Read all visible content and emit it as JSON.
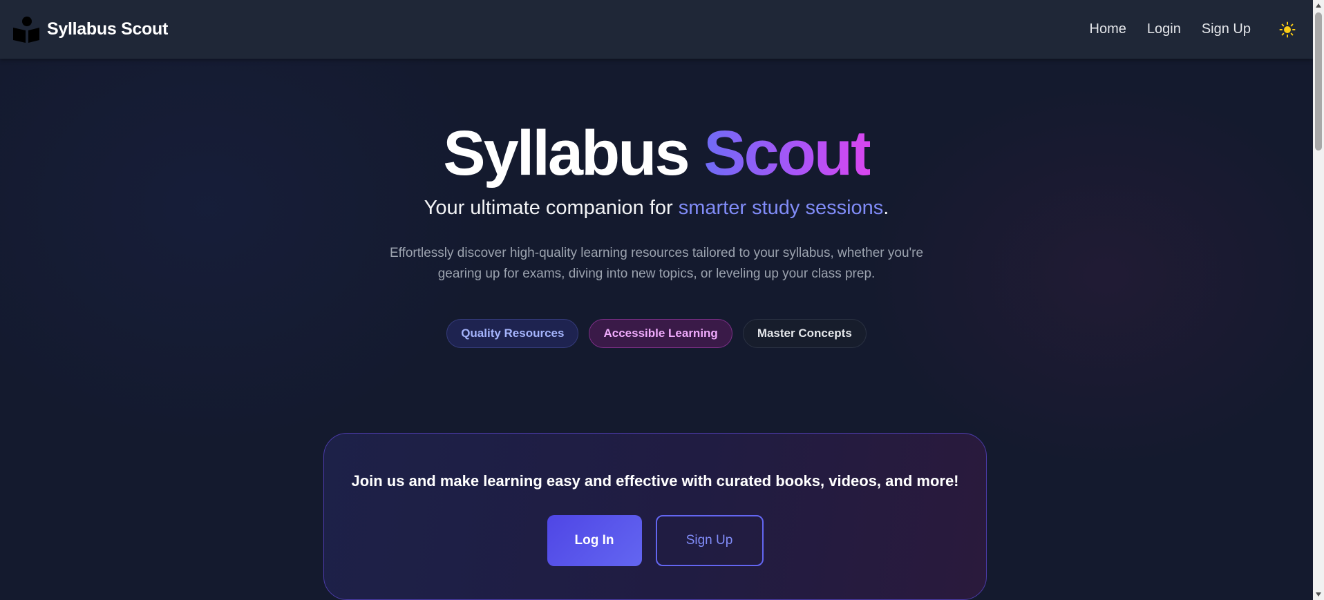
{
  "nav": {
    "brand": "Syllabus Scout",
    "links": [
      "Home",
      "Login",
      "Sign Up"
    ],
    "theme_icon": "sun-icon"
  },
  "hero": {
    "title_part1": "Syllabus",
    "title_part2": "Scout",
    "subtitle_prefix": "Your ultimate companion for ",
    "subtitle_highlight": "smarter study sessions",
    "subtitle_suffix": ".",
    "description": "Effortlessly discover high-quality learning resources tailored to your syllabus, whether you're gearing up for exams, diving into new topics, or leveling up your class prep.",
    "pills": [
      "Quality Resources",
      "Accessible Learning",
      "Master Concepts"
    ]
  },
  "cta": {
    "text": "Join us and make learning easy and effective with curated books, videos, and more!",
    "login_label": "Log In",
    "signup_label": "Sign Up"
  },
  "colors": {
    "background": "#141a2e",
    "navbar": "#1f2737",
    "accent": "#6366f1",
    "gradient_end": "#d946ef",
    "sun": "#facc15"
  }
}
